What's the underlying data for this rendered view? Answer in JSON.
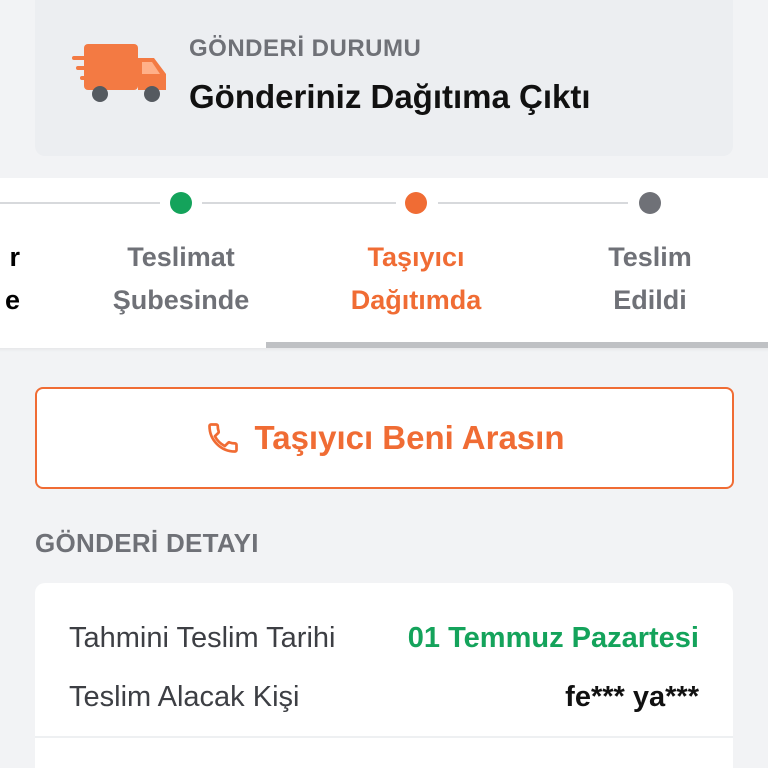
{
  "status": {
    "label": "GÖNDERİ DURUMU",
    "title": "Gönderiniz Dağıtıma Çıktı",
    "icon": "delivery-truck-icon",
    "accent": "#f06c34"
  },
  "tracker": {
    "steps": [
      {
        "line1": "r",
        "line2": "e",
        "dot_color": "",
        "text_color": "#6f7177"
      },
      {
        "line1": "Teslimat",
        "line2": "Şubesinde",
        "dot_color": "#14a35b",
        "text_color": "#6f7177"
      },
      {
        "line1": "Taşıyıcı",
        "line2": "Dağıtımda",
        "dot_color": "#f06c34",
        "text_color": "#f06c34"
      },
      {
        "line1": "Teslim",
        "line2": "Edildi",
        "dot_color": "#6f7177",
        "text_color": "#6f7177"
      }
    ]
  },
  "call_button": {
    "label": "Taşıyıcı Beni Arasın",
    "icon": "phone-icon"
  },
  "details": {
    "section_title": "GÖNDERİ DETAYI",
    "rows": [
      {
        "key": "Tahmini Teslim Tarihi",
        "value": "01 Temmuz Pazartesi"
      },
      {
        "key": "Teslim Alacak Kişi",
        "value": "fe*** ya***"
      }
    ]
  }
}
